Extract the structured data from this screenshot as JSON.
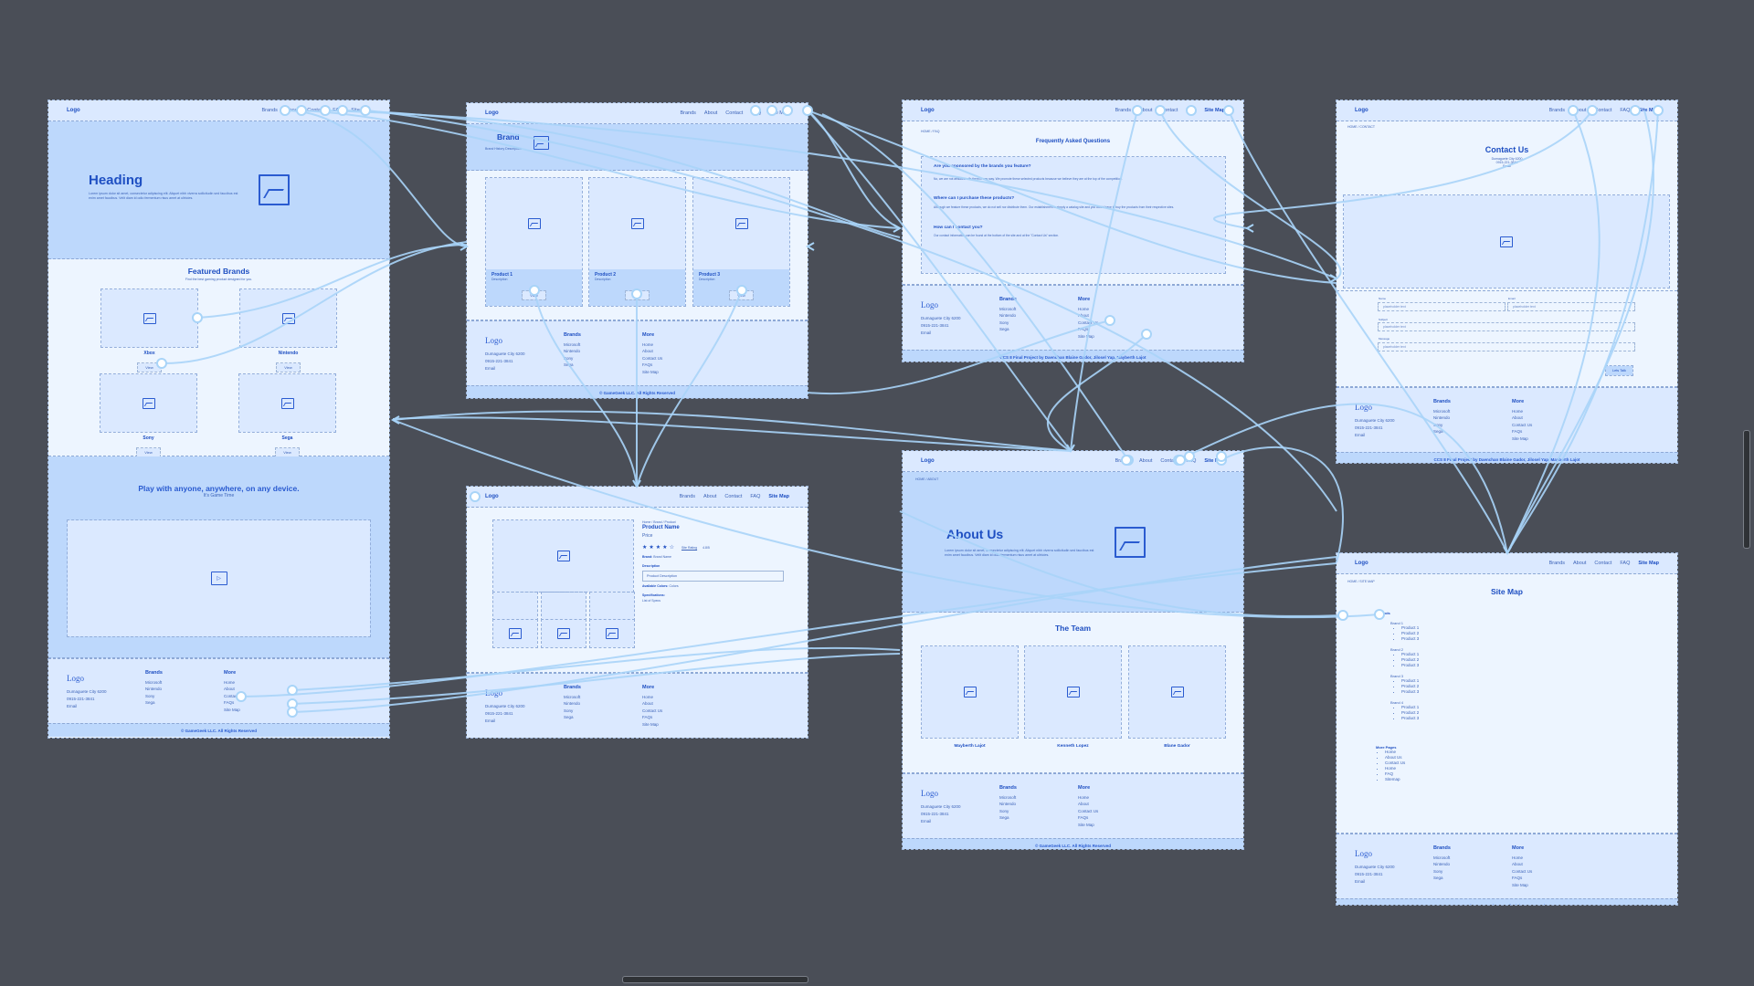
{
  "canvas": {
    "background": "#4a4e57",
    "connector_color": "#a8d4f8",
    "frame_color": "#edf5ff",
    "accent": "#1e4fc2"
  },
  "nav": {
    "logo": "Logo",
    "links": [
      "Brands",
      "About",
      "Contact",
      "FAQ",
      "Site Map"
    ]
  },
  "footer": {
    "logo": "Logo",
    "address": "Dumaguete City 6200",
    "phone": "0915-221-3841",
    "email": "Email",
    "brands_title": "Brands",
    "brands": [
      "Microsoft",
      "Nintendo",
      "Sony",
      "Sega"
    ],
    "more_title": "More",
    "more": [
      "Home",
      "About",
      "Contact Us",
      "FAQs",
      "Site Map"
    ],
    "copyright": "© GameGeek LLC. All Rights Reserved",
    "credits": "CCS 8 Final Project by Daenchan Blaine Gador, Jilosel Yap, Mayberth Lajot"
  },
  "home": {
    "heading": "Heading",
    "lorem": "Lorem ipsum dolor sit amet, consectetur adipiscing elit. Aliquet nibh viverra sollicitudin sed faucibus est enim amet faucibus. Velit diam id odio fermentum risus amet at ultricies.",
    "featured_title": "Featured Brands",
    "featured_sub": "Find the best gaming product designed for you.",
    "brands": [
      {
        "name": "Xbox",
        "button": "View"
      },
      {
        "name": "Nintendo",
        "button": "View"
      },
      {
        "name": "Sony",
        "button": "View"
      },
      {
        "name": "Sega",
        "button": "View"
      }
    ],
    "promo_title": "Play with anyone, anywhere, on any device.",
    "promo_sub": "It's Game Time"
  },
  "brand": {
    "title": "Brand",
    "desc": "Brand History Description",
    "products": [
      {
        "name": "Product 1",
        "desc": "Description",
        "button": "View"
      },
      {
        "name": "Product 2",
        "desc": "Description",
        "button": "View"
      },
      {
        "name": "Product 3",
        "desc": "Description",
        "button": "View"
      }
    ]
  },
  "product": {
    "breadcrumb": "Home / Brand / Product",
    "name": "Product Name",
    "price": "Price",
    "rating_value": 4,
    "rating_max": 5,
    "rating_link": "Site Rating",
    "rating_text": "4.8/5",
    "brand_label": "Brand:",
    "brand_value": "Brand Name",
    "description_label": "Description",
    "description_value": "Product Description",
    "colors_label": "Available Colors:",
    "colors_value": "Colors",
    "specs_label": "Specifications:",
    "specs_value": "List of Specs"
  },
  "faq": {
    "breadcrumb": "HOME / FAQ",
    "title": "Frequently Asked Questions",
    "items": [
      {
        "q": "Are you sponsored by the brands you feature?",
        "a": "No, we are not affiliated with them in any way. We promote these selected products because we believe they are at the top of the competition."
      },
      {
        "q": "Where can I purchase these products?",
        "a": "Although we feature these products, we do not sell nor distribute them. Our establishment is simply a catalog site and you would have to buy the products from their respective sites."
      },
      {
        "q": "How can I contact you?",
        "a": "Our contact information can be found at the bottom of the site and at the \"Contact Us\" section."
      }
    ]
  },
  "contact": {
    "breadcrumb": "HOME / CONTACT",
    "title": "Contact Us",
    "address": "Dumaguete City 6200",
    "phone": "0915-221-3841",
    "email": "Email",
    "fields": [
      {
        "label": "Name",
        "placeholder": "placeholder text"
      },
      {
        "label": "Email",
        "placeholder": "placeholder text"
      },
      {
        "label": "Subject",
        "placeholder": "placeholder text"
      },
      {
        "label": "Message",
        "placeholder": "placeholder text"
      }
    ],
    "submit": "Lets Talk"
  },
  "about": {
    "breadcrumb": "HOME / ABOUT",
    "title": "About Us",
    "lorem": "Lorem ipsum dolor sit amet, consectetur adipiscing elit. Aliquet nibh viverra sollicitudin sed faucibus est enim amet faucibus. Velit diam id odio fermentum risus amet at ultricies.",
    "team_title": "The Team",
    "team": [
      "Mayberth Lajot",
      "Kenneth Lopez",
      "Blane Gador"
    ]
  },
  "sitemap": {
    "breadcrumb": "HOME / SITE MAP",
    "title": "Site Map",
    "brands_heading": "Brands",
    "brands": [
      {
        "name": "Brand 1",
        "products": [
          "Product 1",
          "Product 2",
          "Product 3"
        ]
      },
      {
        "name": "Brand 2",
        "products": [
          "Product 1",
          "Product 2",
          "Product 3"
        ]
      },
      {
        "name": "Brand 3",
        "products": [
          "Product 1",
          "Product 2",
          "Product 3"
        ]
      },
      {
        "name": "Brand 4",
        "products": [
          "Product 1",
          "Product 2",
          "Product 3"
        ]
      }
    ],
    "more_heading": "More Pages",
    "more": [
      "Home",
      "About Us",
      "Contact Us",
      "Home",
      "FAQ",
      "Sitemap"
    ]
  }
}
